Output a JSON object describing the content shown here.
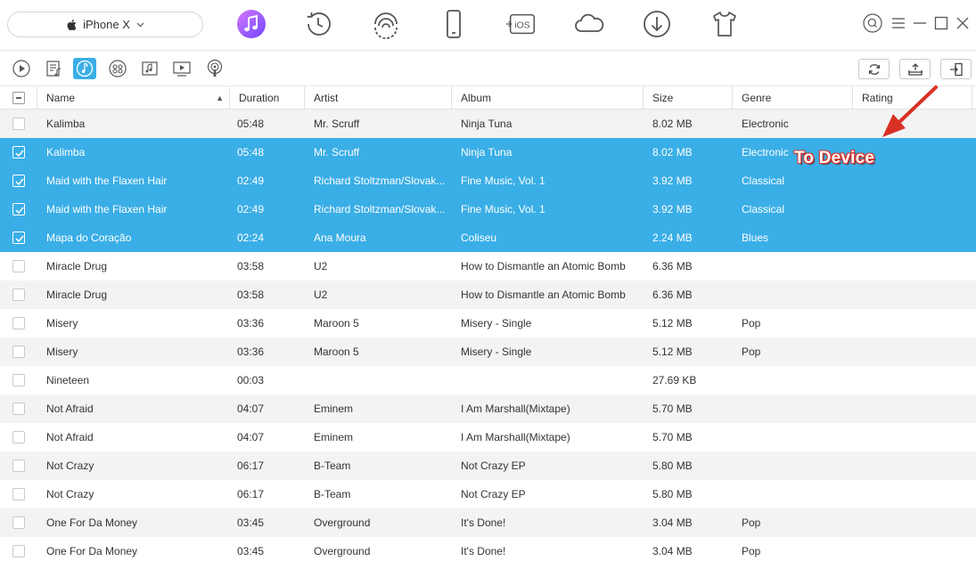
{
  "device": {
    "name": "iPhone X"
  },
  "top_nav": [
    {
      "name": "music-manager-icon",
      "active": true
    },
    {
      "name": "history-icon"
    },
    {
      "name": "wifi-transfer-icon"
    },
    {
      "name": "phone-icon"
    },
    {
      "name": "ios-mover-icon"
    },
    {
      "name": "icloud-icon"
    },
    {
      "name": "download-icon"
    },
    {
      "name": "tshirt-icon"
    }
  ],
  "window_controls": [
    "search-circle-icon",
    "menu-icon",
    "minimize-icon",
    "maximize-icon",
    "close-icon"
  ],
  "categories": [
    "music-icon",
    "playlist-icon",
    "ringtone-icon",
    "audiobook-icon",
    "music-video-icon",
    "tv-icon",
    "podcast-icon"
  ],
  "active_category": "ringtone-icon",
  "actions": [
    "refresh-icon",
    "export-to-computer-icon",
    "to-device-icon"
  ],
  "columns": {
    "name": "Name",
    "duration": "Duration",
    "artist": "Artist",
    "album": "Album",
    "size": "Size",
    "genre": "Genre",
    "rating": "Rating"
  },
  "rows": [
    {
      "name": "Kalimba",
      "duration": "05:48",
      "artist": "Mr. Scruff",
      "album": "Ninja Tuna",
      "size": "8.02 MB",
      "genre": "Electronic",
      "selected": false
    },
    {
      "name": "Kalimba",
      "duration": "05:48",
      "artist": "Mr. Scruff",
      "album": "Ninja Tuna",
      "size": "8.02 MB",
      "genre": "Electronic",
      "selected": true
    },
    {
      "name": "Maid with the Flaxen Hair",
      "duration": "02:49",
      "artist": "Richard Stoltzman/Slovak...",
      "album": "Fine Music, Vol. 1",
      "size": "3.92 MB",
      "genre": "Classical",
      "selected": true
    },
    {
      "name": "Maid with the Flaxen Hair",
      "duration": "02:49",
      "artist": "Richard Stoltzman/Slovak...",
      "album": "Fine Music, Vol. 1",
      "size": "3.92 MB",
      "genre": "Classical",
      "selected": true
    },
    {
      "name": "Mapa do Coração",
      "duration": "02:24",
      "artist": "Ana Moura",
      "album": "Coliseu",
      "size": "2.24 MB",
      "genre": "Blues",
      "selected": true
    },
    {
      "name": "Miracle Drug",
      "duration": "03:58",
      "artist": "U2",
      "album": "How to Dismantle an Atomic Bomb",
      "size": "6.36 MB",
      "genre": "",
      "selected": false
    },
    {
      "name": "Miracle Drug",
      "duration": "03:58",
      "artist": "U2",
      "album": "How to Dismantle an Atomic Bomb",
      "size": "6.36 MB",
      "genre": "",
      "selected": false
    },
    {
      "name": "Misery",
      "duration": "03:36",
      "artist": "Maroon 5",
      "album": "Misery - Single",
      "size": "5.12 MB",
      "genre": "Pop",
      "selected": false
    },
    {
      "name": "Misery",
      "duration": "03:36",
      "artist": "Maroon 5",
      "album": "Misery - Single",
      "size": "5.12 MB",
      "genre": "Pop",
      "selected": false
    },
    {
      "name": "Nineteen",
      "duration": "00:03",
      "artist": "",
      "album": "",
      "size": "27.69 KB",
      "genre": "",
      "selected": false
    },
    {
      "name": "Not Afraid",
      "duration": "04:07",
      "artist": "Eminem",
      "album": "I Am Marshall(Mixtape)",
      "size": "5.70 MB",
      "genre": "",
      "selected": false
    },
    {
      "name": "Not Afraid",
      "duration": "04:07",
      "artist": "Eminem",
      "album": "I Am Marshall(Mixtape)",
      "size": "5.70 MB",
      "genre": "",
      "selected": false
    },
    {
      "name": "Not Crazy",
      "duration": "06:17",
      "artist": "B-Team",
      "album": "Not Crazy EP",
      "size": "5.80 MB",
      "genre": "",
      "selected": false
    },
    {
      "name": "Not Crazy",
      "duration": "06:17",
      "artist": "B-Team",
      "album": "Not Crazy EP",
      "size": "5.80 MB",
      "genre": "",
      "selected": false
    },
    {
      "name": "One For Da Money",
      "duration": "03:45",
      "artist": "Overground",
      "album": "It's Done!",
      "size": "3.04 MB",
      "genre": "Pop",
      "selected": false
    },
    {
      "name": "One For Da Money",
      "duration": "03:45",
      "artist": "Overground",
      "album": "It's Done!",
      "size": "3.04 MB",
      "genre": "Pop",
      "selected": false
    }
  ],
  "annotation": {
    "label": "To Device"
  },
  "colors": {
    "accent": "#3aaee6",
    "music_gradient_start": "#c86dfb",
    "music_gradient_end": "#7b4dff",
    "annotation": "#d93025"
  }
}
